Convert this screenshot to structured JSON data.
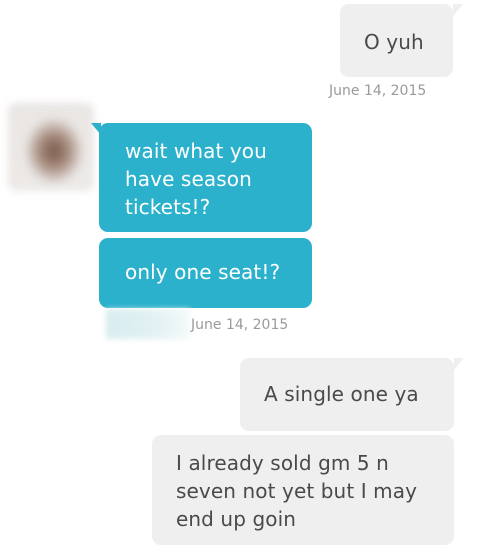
{
  "messages": [
    {
      "id": "m1",
      "text": "O yuh"
    },
    {
      "id": "m2",
      "text": "wait what you have season tickets!?"
    },
    {
      "id": "m3",
      "text": "only one seat!?"
    },
    {
      "id": "m4",
      "text": "A single one ya"
    },
    {
      "id": "m5",
      "text": "I already sold gm 5 n seven not yet but I may end up goin"
    }
  ],
  "timestamps": {
    "after_m1": "June 14, 2015",
    "after_m3": "June 14, 2015"
  },
  "colors": {
    "incoming_bubble": "#2bb1cc",
    "outgoing_bubble": "#efefef",
    "timestamp_text": "#9a9a9a"
  }
}
